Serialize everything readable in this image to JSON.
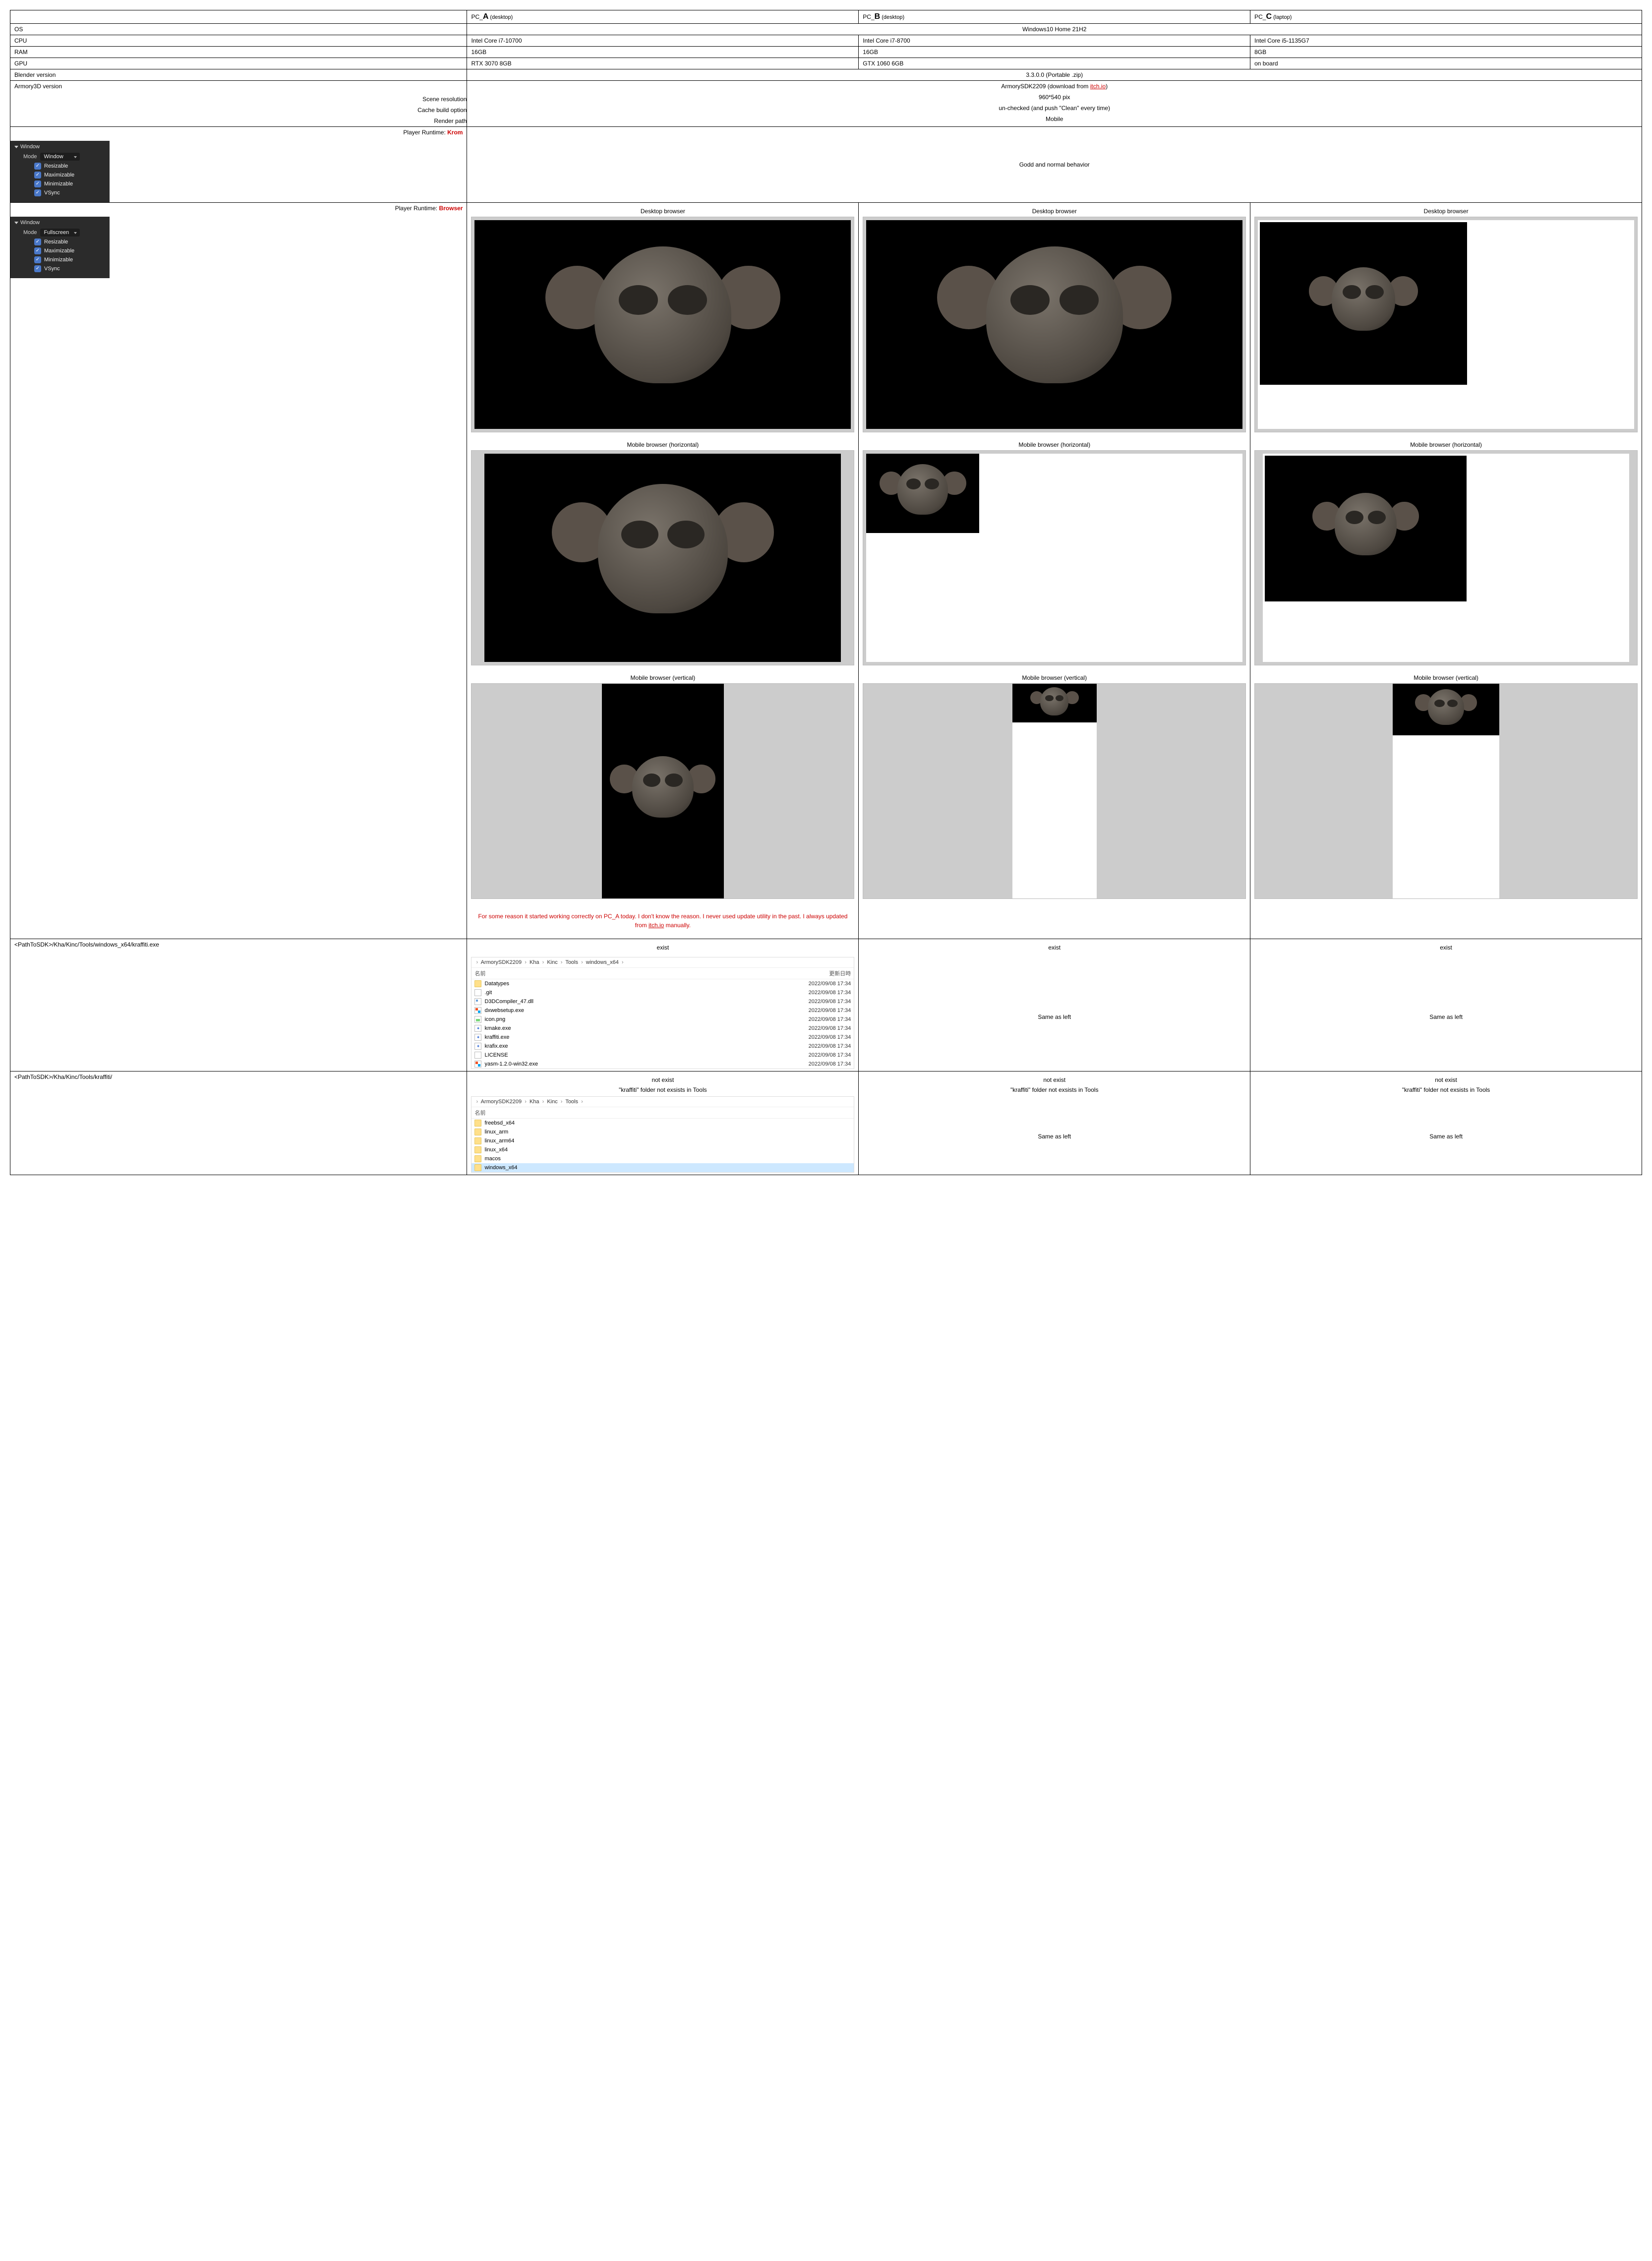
{
  "headers": {
    "pc_a_pre": "PC_",
    "pc_a_big": "A",
    "pc_a_suf": " (desktop)",
    "pc_b_pre": "PC_",
    "pc_b_big": "B",
    "pc_b_suf": " (desktop)",
    "pc_c_pre": "PC_",
    "pc_c_big": "C",
    "pc_c_suf": " (laptop)"
  },
  "rows": {
    "os_label": "OS",
    "os_value": "Windows10 Home 21H2",
    "cpu_label": "CPU",
    "cpu_a": "Intel Core i7-10700",
    "cpu_b": "Intel Core i7-8700",
    "cpu_c": "Intel Core i5-1135G7",
    "ram_label": "RAM",
    "ram_a": "16GB",
    "ram_b": "16GB",
    "ram_c": "8GB",
    "gpu_label": "GPU",
    "gpu_a": "RTX 3070 8GB",
    "gpu_b": "GTX 1060 6GB",
    "gpu_c": "on board",
    "blender_label": "Blender version",
    "blender_value": "3.3.0.0 (Portable .zip)",
    "armory_label": "Armory3D version",
    "armory_value_pre": "ArmorySDK2209 (download from ",
    "armory_value_link": "itch.io",
    "armory_value_post": ")",
    "scene_res_label": "Scene resolution",
    "scene_res_value": "960*540 pix",
    "cache_label": "Cache build option",
    "cache_value": "un-checked (and push \"Clean\" every time)",
    "render_label": "Render path",
    "render_value": "Mobile"
  },
  "krom": {
    "label_pre": "Player Runtime: ",
    "label_val": "Krom",
    "panel_title": "Window",
    "mode_label": "Mode",
    "mode_value": "Window",
    "chk1": "Resizable",
    "chk2": "Maximizable",
    "chk3": "Minimizable",
    "chk4": "VSync",
    "result": "Godd and normal behavior"
  },
  "browser": {
    "label_pre": "Player Runtime: ",
    "label_val": "Browser",
    "panel_title": "Window",
    "mode_label": "Mode",
    "mode_value": "Fullscreen",
    "chk1": "Resizable",
    "chk2": "Maximizable",
    "chk3": "Minimizable",
    "chk4": "VSync",
    "shot_desktop": "Desktop browser",
    "shot_mh": "Mobile browser (horizontal)",
    "shot_mv": "Mobile browser (vertical)",
    "note_a": "For some reason it started working correctly on PC_A today. I don't know the reason. I never used update utility in the past. I always updated from ",
    "note_link": "itch.io",
    "note_post": " manually."
  },
  "kraffiti_exe": {
    "label": "<PathToSDK>/Kha/Kinc/Tools/windows_x64/kraffiti.exe",
    "exist": "exist",
    "same": "Same as left",
    "path_parts": [
      "ArmorySDK2209",
      "Kha",
      "Kinc",
      "Tools",
      "windows_x64"
    ],
    "col_name": "名前",
    "col_date": "更新日時",
    "files": [
      {
        "icon": "folder",
        "name": "Datatypes",
        "date": "2022/09/08 17:34"
      },
      {
        "icon": "doc",
        "name": ".git",
        "date": "2022/09/08 17:34"
      },
      {
        "icon": "dll",
        "name": "D3DCompiler_47.dll",
        "date": "2022/09/08 17:34"
      },
      {
        "icon": "win",
        "name": "dxwebsetup.exe",
        "date": "2022/09/08 17:34"
      },
      {
        "icon": "img",
        "name": "icon.png",
        "date": "2022/09/08 17:34"
      },
      {
        "icon": "exe",
        "name": "kmake.exe",
        "date": "2022/09/08 17:34"
      },
      {
        "icon": "exe",
        "name": "kraffiti.exe",
        "date": "2022/09/08 17:34"
      },
      {
        "icon": "exe",
        "name": "krafix.exe",
        "date": "2022/09/08 17:34"
      },
      {
        "icon": "doc",
        "name": "LICENSE",
        "date": "2022/09/08 17:34"
      },
      {
        "icon": "win",
        "name": "yasm-1.2.0-win32.exe",
        "date": "2022/09/08 17:34"
      }
    ]
  },
  "kraffiti_dir": {
    "label": "<PathToSDK>/Kha/Kinc/Tools/kraffiti/",
    "not_exist": "not exist",
    "msg": "\"kraffiti\" folder not exsists in Tools",
    "same": "Same as left",
    "path_parts": [
      "ArmorySDK2209",
      "Kha",
      "Kinc",
      "Tools"
    ],
    "col_name": "名前",
    "folders": [
      {
        "name": "freebsd_x64",
        "sel": false
      },
      {
        "name": "linux_arm",
        "sel": false
      },
      {
        "name": "linux_arm64",
        "sel": false
      },
      {
        "name": "linux_x64",
        "sel": false
      },
      {
        "name": "macos",
        "sel": false
      },
      {
        "name": "windows_x64",
        "sel": true
      }
    ]
  }
}
